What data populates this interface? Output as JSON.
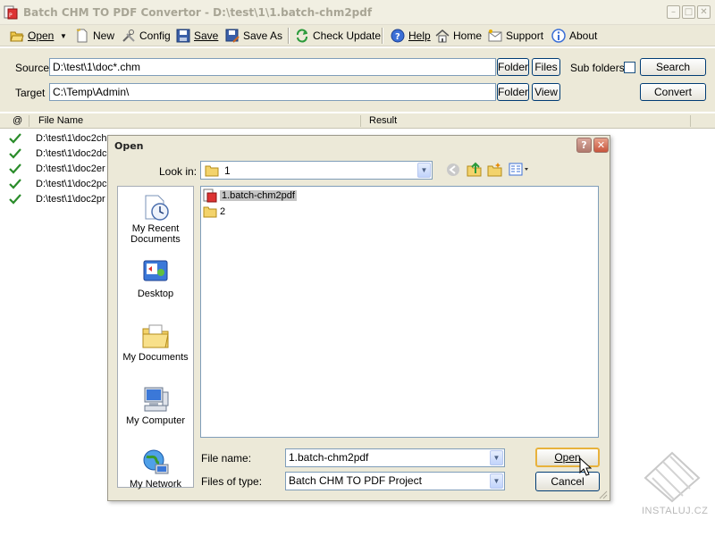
{
  "window": {
    "title": "Batch CHM TO PDF Convertor - D:\\test\\1\\1.batch-chm2pdf"
  },
  "toolbar": {
    "open": "Open",
    "new": "New",
    "config": "Config",
    "save": "Save",
    "save_as": "Save As",
    "check_update": "Check Update",
    "help": "Help",
    "home": "Home",
    "support": "Support",
    "about": "About"
  },
  "source": {
    "label": "Source",
    "value": "D:\\test\\1\\doc*.chm",
    "folder_btn": "Folder",
    "files_btn": "Files",
    "subfolders_label": "Sub folders",
    "search_btn": "Search"
  },
  "target": {
    "label": "Target",
    "value": "C:\\Temp\\Admin\\",
    "folder_btn": "Folder",
    "view_btn": "View",
    "convert_btn": "Convert"
  },
  "list": {
    "columns": [
      "@",
      "File Name",
      "Result"
    ],
    "rows": [
      {
        "name": "D:\\test\\1\\doc2ch"
      },
      {
        "name": "D:\\test\\1\\doc2dc"
      },
      {
        "name": "D:\\test\\1\\doc2er"
      },
      {
        "name": "D:\\test\\1\\doc2pc"
      },
      {
        "name": "D:\\test\\1\\doc2pr"
      }
    ]
  },
  "dialog": {
    "title": "Open",
    "look_in_label": "Look in:",
    "look_in_value": "1",
    "places": [
      "My Recent Documents",
      "Desktop",
      "My Documents",
      "My Computer",
      "My Network"
    ],
    "files": [
      {
        "name": "1.batch-chm2pdf",
        "icon": "chm2pdf-file-icon",
        "selected": true
      },
      {
        "name": "2",
        "icon": "folder-icon",
        "selected": false
      }
    ],
    "file_name_label": "File name:",
    "file_name_value": "1.batch-chm2pdf",
    "files_of_type_label": "Files of type:",
    "files_of_type_value": "Batch CHM TO PDF Project",
    "open_btn": "Open",
    "cancel_btn": "Cancel"
  },
  "watermark": "INSTALUJ.CZ"
}
